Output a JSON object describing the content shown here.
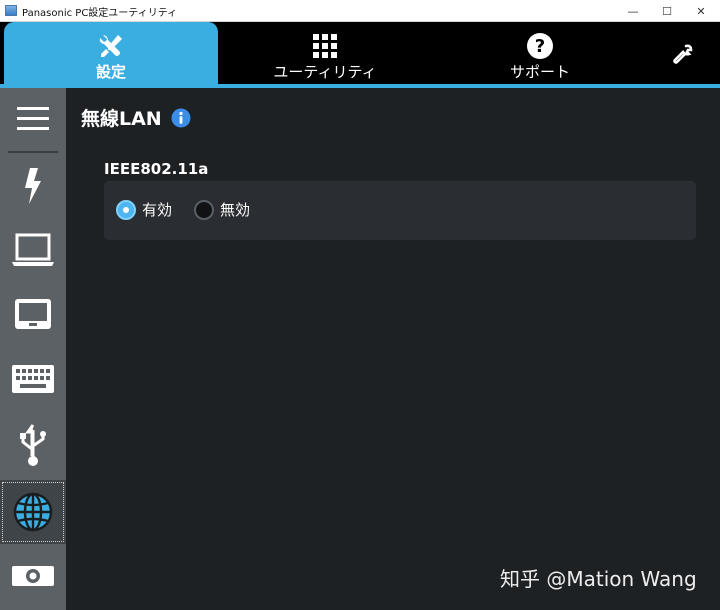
{
  "window": {
    "title": "Panasonic PC設定ユーティリティ",
    "minimize": "—",
    "maximize": "☐",
    "close": "✕"
  },
  "tabs": [
    {
      "label": "設定",
      "icon": "tools-icon",
      "active": true
    },
    {
      "label": "ユーティリティ",
      "icon": "grid-icon",
      "active": false
    },
    {
      "label": "サポート",
      "icon": "help-icon",
      "active": false
    }
  ],
  "sidebar": {
    "items": [
      {
        "icon": "hamburger-menu-icon"
      },
      {
        "icon": "lightning-bolt-icon"
      },
      {
        "icon": "laptop-icon"
      },
      {
        "icon": "display-icon"
      },
      {
        "icon": "keyboard-icon"
      },
      {
        "icon": "usb-icon"
      },
      {
        "icon": "globe-icon",
        "selected": true
      },
      {
        "icon": "camera-icon"
      }
    ]
  },
  "main": {
    "title": "無線LAN",
    "section": {
      "label": "IEEE802.11a",
      "options": [
        {
          "label": "有効",
          "selected": true
        },
        {
          "label": "無効",
          "selected": false
        }
      ]
    }
  },
  "watermark": "知乎 @Mation Wang",
  "colors": {
    "accent": "#3aaee0",
    "background": "#1e2124",
    "sidebar": "#5c6166",
    "panel": "#2a2d31"
  }
}
